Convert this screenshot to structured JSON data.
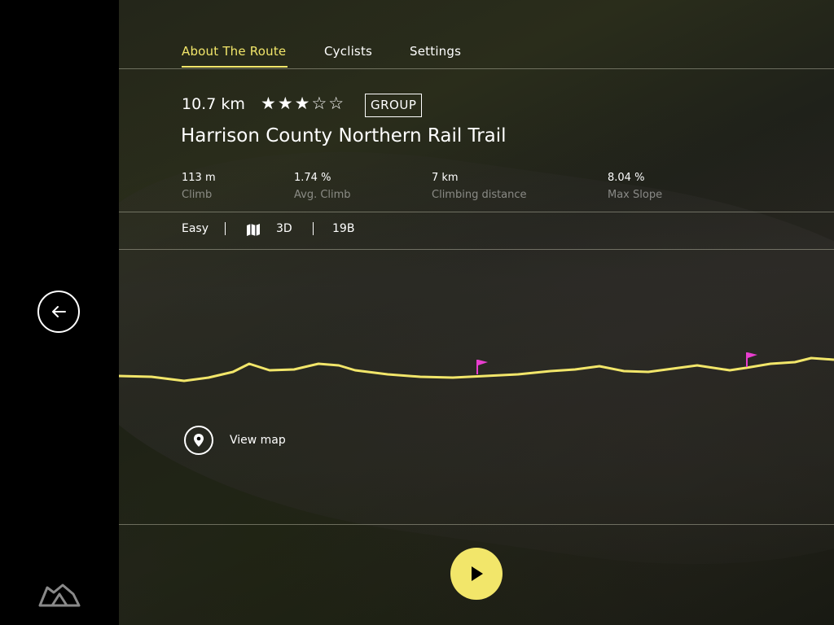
{
  "tabs": [
    {
      "label": "About The Route",
      "active": true
    },
    {
      "label": "Cyclists",
      "active": false
    },
    {
      "label": "Settings",
      "active": false
    }
  ],
  "route": {
    "distance": "10.7 km",
    "rating": 3,
    "rating_max": 5,
    "rating_display": "★★★☆☆",
    "type_badge": "GROUP",
    "title": "Harrison County Northern Rail Trail"
  },
  "stats": [
    {
      "value": "113 m",
      "label": "Climb"
    },
    {
      "value": "1.74 %",
      "label": "Avg. Climb"
    },
    {
      "value": "7 km",
      "label": "Climbing distance"
    },
    {
      "value": "8.04 %",
      "label": "Max Slope"
    }
  ],
  "meta": {
    "difficulty": "Easy",
    "view_mode": "3D",
    "count": "19B"
  },
  "view_map_label": "View map",
  "icons": {
    "back": "arrow-left-icon",
    "map": "map-icon",
    "pin": "location-pin-icon",
    "play": "play-icon",
    "logo": "app-logo-icon",
    "flag": "flag-icon"
  },
  "colors": {
    "accent": "#f2e66a",
    "flag": "#e83ecf",
    "background": "#000000"
  }
}
